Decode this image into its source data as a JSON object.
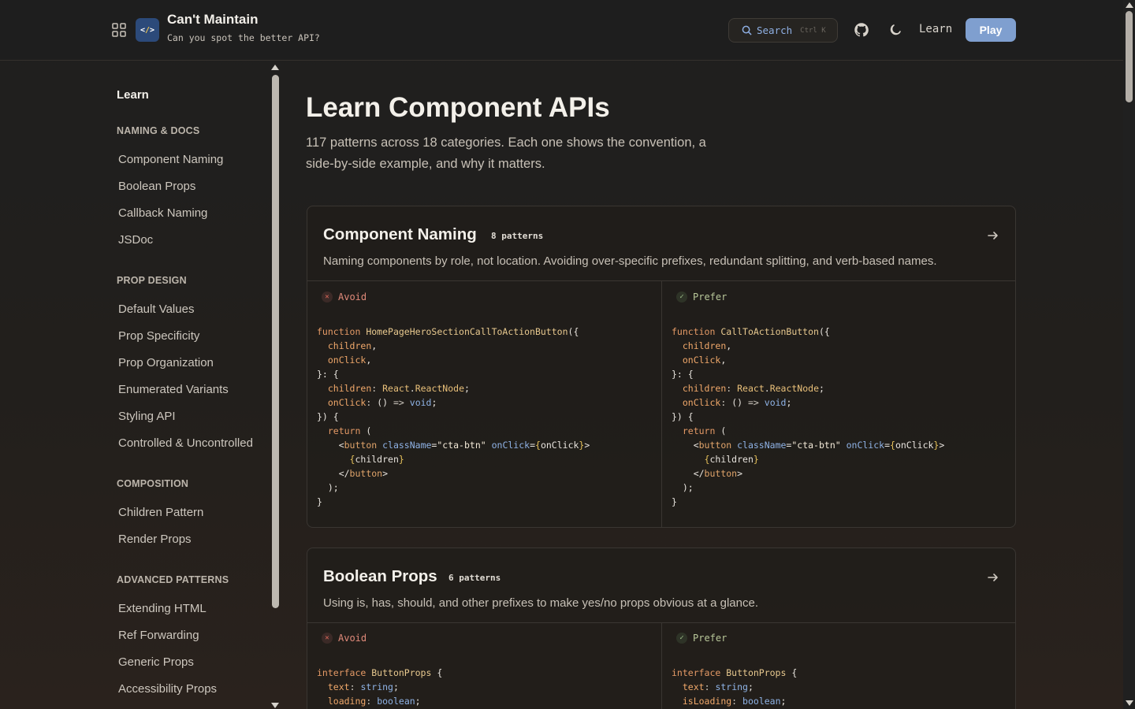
{
  "header": {
    "title": "Can't Maintain",
    "subtitle": "Can you spot the better API?",
    "logo_text_left": "<",
    "logo_text_mid": "/",
    "logo_text_right": ">",
    "search_label": "Search",
    "search_shortcut": "Ctrl K",
    "nav_learn": "Learn",
    "play_label": "Play"
  },
  "sidebar": {
    "heading": "Learn",
    "sections": [
      {
        "title": "NAMING & DOCS",
        "items": [
          "Component Naming",
          "Boolean Props",
          "Callback Naming",
          "JSDoc"
        ]
      },
      {
        "title": "PROP DESIGN",
        "items": [
          "Default Values",
          "Prop Specificity",
          "Prop Organization",
          "Enumerated Variants",
          "Styling API",
          "Controlled & Uncontrolled"
        ]
      },
      {
        "title": "COMPOSITION",
        "items": [
          "Children Pattern",
          "Render Props"
        ]
      },
      {
        "title": "ADVANCED PATTERNS",
        "items": [
          "Extending HTML",
          "Ref Forwarding",
          "Generic Props",
          "Accessibility Props"
        ]
      }
    ]
  },
  "main": {
    "title": "Learn Component APIs",
    "intro": "117 patterns across 18 categories. Each one shows the convention, a side-by-side example, and why it matters.",
    "cards": [
      {
        "title": "Component Naming",
        "count": "8 patterns",
        "description": "Naming components by role, not location. Avoiding over-specific prefixes, redundant splitting, and verb-based names.",
        "avoid_label": "Avoid",
        "prefer_label": "Prefer",
        "avoid_fn": "HomePageHeroSectionCallToActionButton",
        "prefer_fn": "CallToActionButton"
      },
      {
        "title": "Boolean Props",
        "count": "6 patterns",
        "description": "Using is, has, should, and other prefixes to make yes/no props obvious at a glance.",
        "avoid_label": "Avoid",
        "prefer_label": "Prefer",
        "avoid_prop": "loading",
        "prefer_prop": "isLoading"
      }
    ]
  },
  "code_tokens": {
    "function": "function",
    "children": "children",
    "onClick": "onClick",
    "react": "React",
    "reactnode": "ReactNode",
    "void": "void",
    "return": "return",
    "button": "button",
    "className": "className",
    "cta": "\"cta-btn\"",
    "interface": "interface",
    "ButtonProps": "ButtonProps",
    "text": "text",
    "string": "string",
    "boolean": "boolean"
  },
  "colors": {
    "accent": "#7f9fcf",
    "avoid": "#e08a7a",
    "prefer": "#b9c89a"
  }
}
